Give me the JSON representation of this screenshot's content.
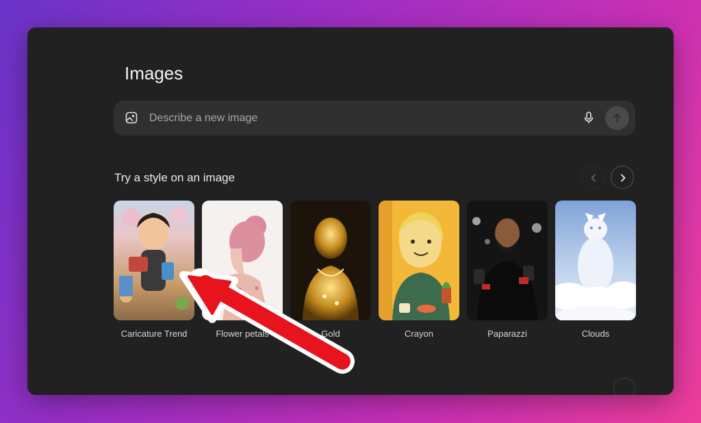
{
  "page": {
    "title": "Images"
  },
  "search": {
    "placeholder": "Describe a new image",
    "leading_icon": "image-icon",
    "mic_icon": "microphone-icon",
    "send_icon": "arrow-up-icon"
  },
  "styles_section": {
    "title": "Try a style on an image",
    "prev_icon": "chevron-left-icon",
    "next_icon": "chevron-right-icon",
    "items": [
      {
        "label": "Caricature Trend"
      },
      {
        "label": "Flower petals"
      },
      {
        "label": "Gold"
      },
      {
        "label": "Crayon"
      },
      {
        "label": "Paparazzi"
      },
      {
        "label": "Clouds"
      }
    ]
  },
  "annotation": {
    "icon": "red-arrow-icon",
    "color": "#e8141d"
  },
  "colors": {
    "window_bg": "#212121",
    "input_bg": "#303030",
    "accent_arrow": "#e8141d"
  }
}
